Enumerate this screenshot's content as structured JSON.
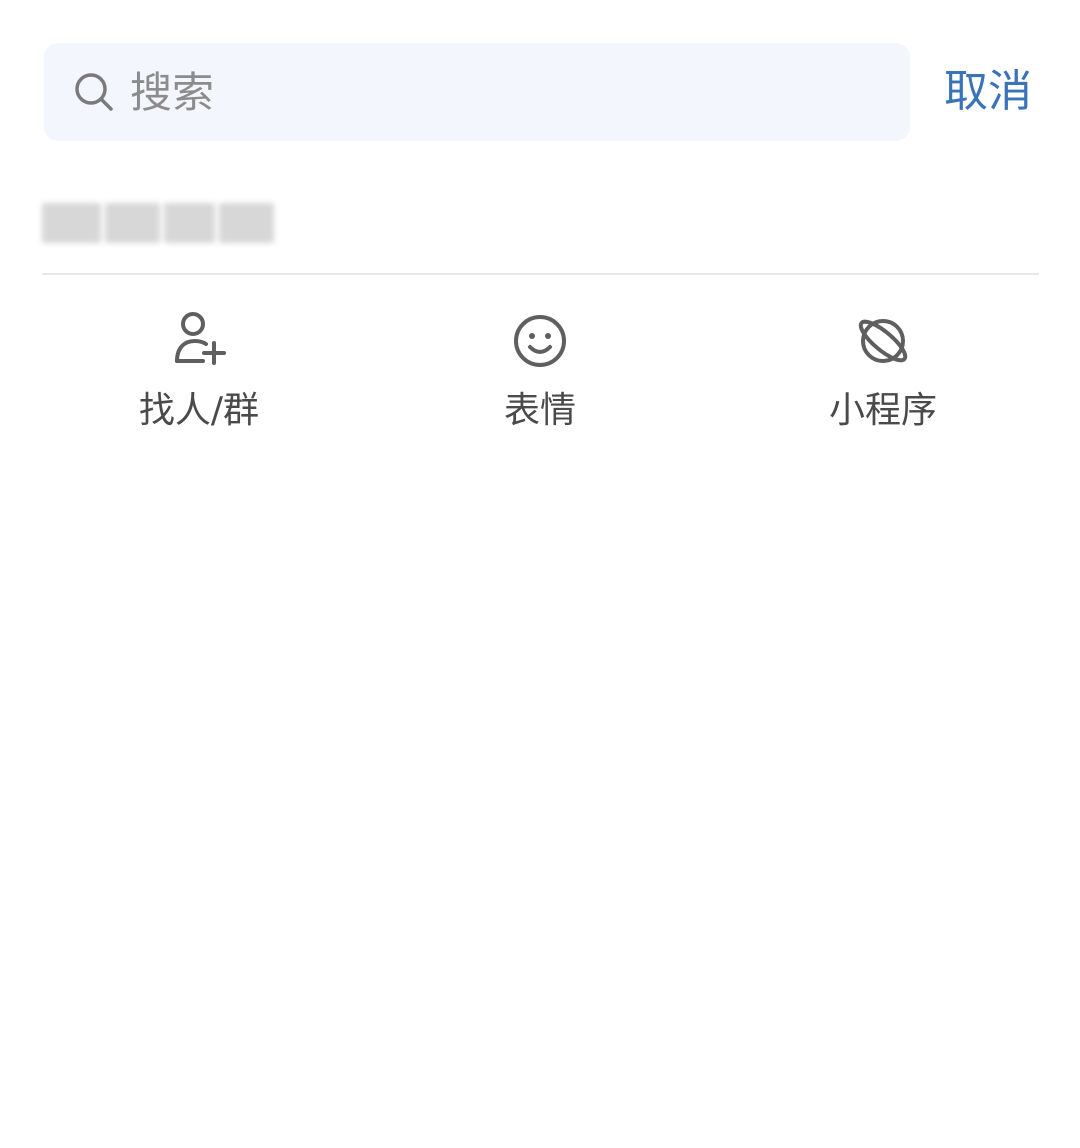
{
  "search": {
    "icon": "search-icon",
    "placeholder": "搜索",
    "value": ""
  },
  "header": {
    "cancel_label": "取消"
  },
  "colors": {
    "accent": "#3b73b9",
    "search_bg": "#f3f7fd",
    "icon_gray": "#5f5f5f",
    "divider": "#e8e8e8"
  },
  "shortcuts": [
    {
      "label": "找人/群",
      "icon": "add-person-icon"
    },
    {
      "label": "表情",
      "icon": "smiley-icon"
    },
    {
      "label": "小程序",
      "icon": "mini-program-planet-icon"
    }
  ]
}
